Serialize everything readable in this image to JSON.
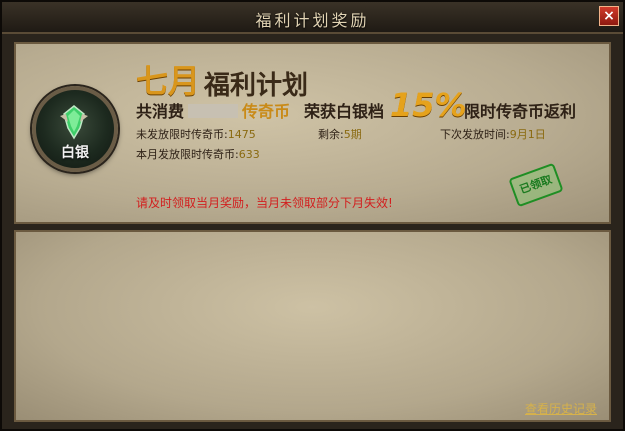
{
  "window": {
    "title": "福利计划奖励",
    "close_glyph": "×"
  },
  "badge": {
    "label": "白银",
    "icon": "green-crest-icon"
  },
  "plan": {
    "month": "七月",
    "name": "福利计划"
  },
  "summary": {
    "spent_prefix": "共消费",
    "currency": "传奇币",
    "tier_text": "荣获白银档",
    "percent": "15%",
    "rebate_text": "限时传奇币返利"
  },
  "stats": {
    "unissued_label": "未发放限时传奇币:",
    "unissued_value": "1475",
    "remaining_label": "剩余:",
    "remaining_value": "5期",
    "next_label": "下次发放时间:",
    "next_value": "9月1日",
    "issued_label": "本月发放限时传奇币:",
    "issued_value": "633"
  },
  "notice": "请及时领取当月奖励，当月未领取部分下月失效!",
  "stamp": "已领取",
  "footer": {
    "history_link": "查看历史记录"
  },
  "colors": {
    "accent": "#d9961c",
    "notice_red": "#d21f1f",
    "link": "#d7b24a"
  }
}
